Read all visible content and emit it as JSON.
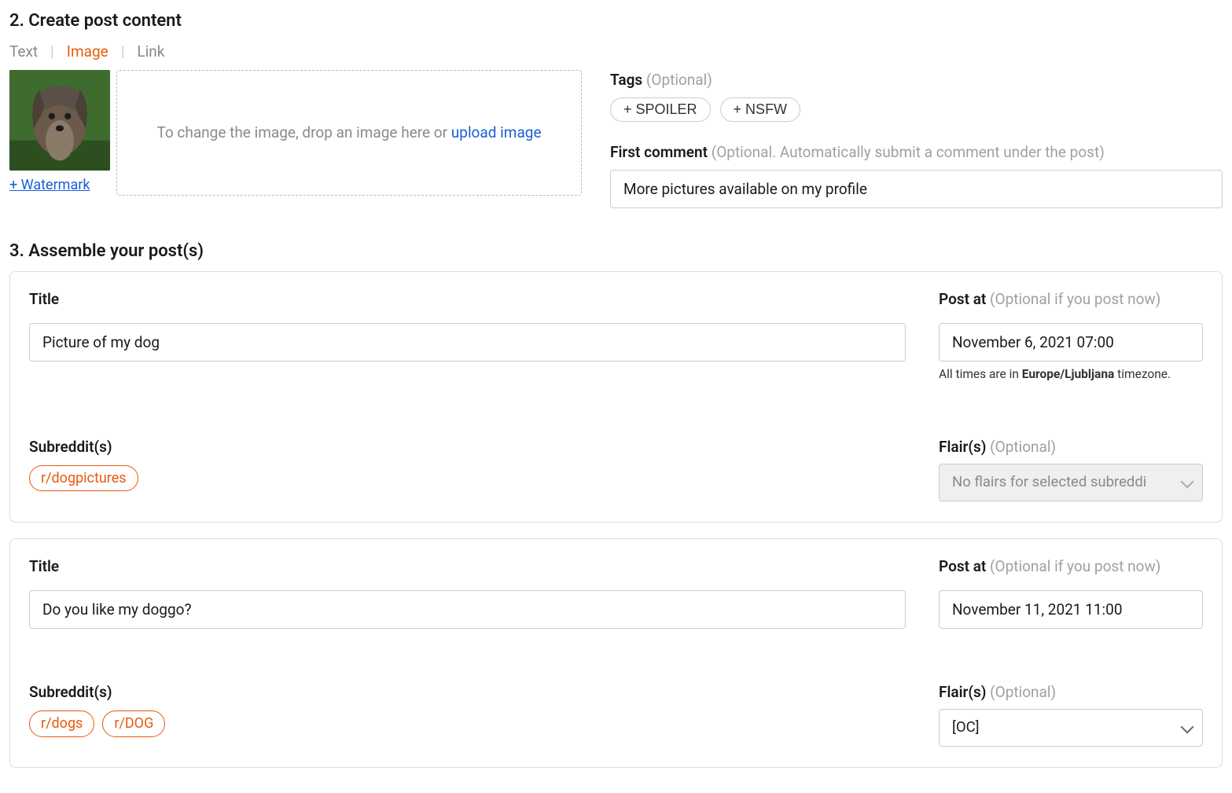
{
  "step2": {
    "heading": "2. Create post content",
    "tabs": {
      "text": "Text",
      "image": "Image",
      "link": "Link"
    },
    "watermark": "+ Watermark",
    "dropzone_prefix": "To change the image, drop an image here or ",
    "dropzone_link": "upload image",
    "tags_label": "Tags ",
    "tags_optional": "(Optional)",
    "tag_spoiler": "+ SPOILER",
    "tag_nsfw": "+ NSFW",
    "first_comment_label": "First comment ",
    "first_comment_optional": "(Optional. Automatically submit a comment under the post)",
    "first_comment_value": "More pictures available on my profile"
  },
  "step3": {
    "heading": "3. Assemble your post(s)",
    "title_label": "Title",
    "subreddit_label": "Subreddit(s)",
    "postat_label": "Post at ",
    "postat_optional": "(Optional if you post now)",
    "flair_label": "Flair(s) ",
    "flair_optional": "(Optional)",
    "tz_prefix": "All times are in ",
    "tz_name": "Europe/Ljubljana",
    "tz_suffix": " timezone.",
    "posts": [
      {
        "title": "Picture of my dog",
        "post_at": "November 6, 2021 07:00",
        "show_tz": true,
        "subreddits": [
          "r/dogpictures"
        ],
        "flair_placeholder": "No flairs for selected subreddi",
        "flair_value": "",
        "flair_disabled": true
      },
      {
        "title": "Do you like my doggo?",
        "post_at": "November 11, 2021 11:00",
        "show_tz": false,
        "subreddits": [
          "r/dogs",
          "r/DOG"
        ],
        "flair_placeholder": "",
        "flair_value": "[OC]",
        "flair_disabled": false
      }
    ]
  }
}
